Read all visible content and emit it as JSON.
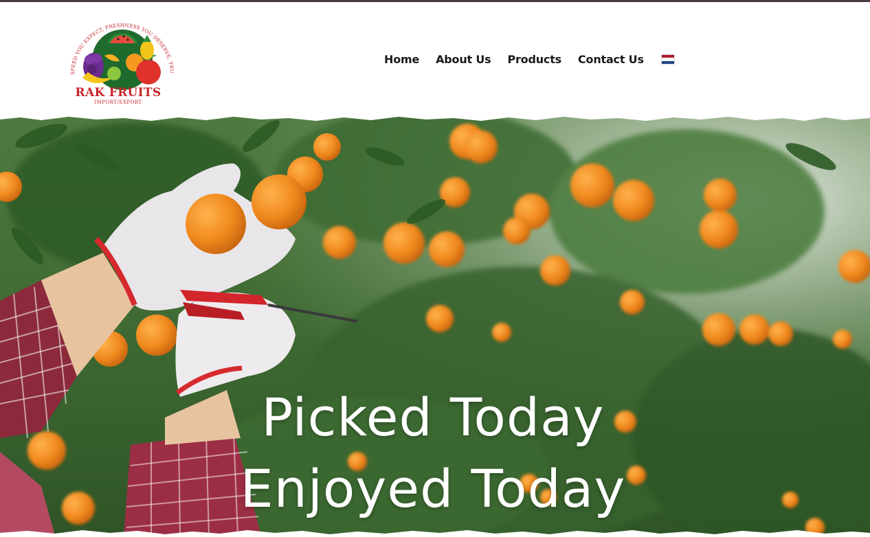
{
  "brand": {
    "name": "RAK FRUITS",
    "subtitle": "IMPORT/EXPORT",
    "slogan": "SPEED YOU EXPECT, FRESHNESS YOU DESERVE, TRUST YOU CAN COUNT ON"
  },
  "nav": {
    "items": [
      {
        "label": "Home"
      },
      {
        "label": "About Us"
      },
      {
        "label": "Products"
      },
      {
        "label": "Contact Us"
      }
    ],
    "language_flag": "netherlands-flag-icon"
  },
  "hero": {
    "headline_line1": "Picked Today",
    "headline_line2": "Enjoyed Today"
  },
  "colors": {
    "brand_red": "#c8252b",
    "nav_text": "#1a1a1a",
    "top_bar": "#4a3a44"
  }
}
